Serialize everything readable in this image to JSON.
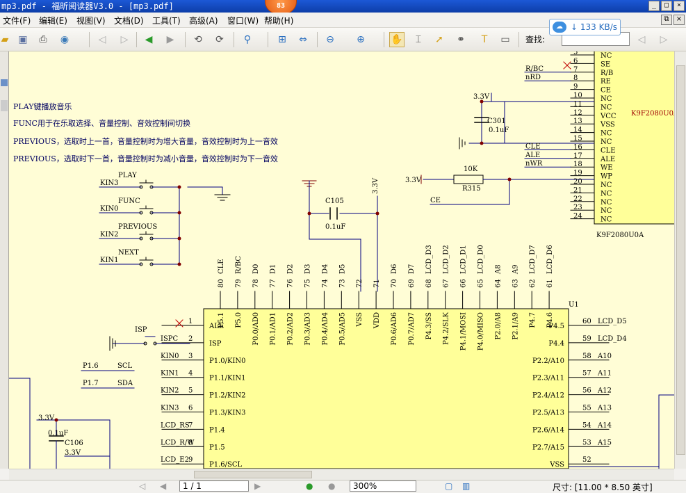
{
  "window": {
    "title": "mp3.pdf - 福昕阅读器V3.0 - [mp3.pdf]",
    "badge": "83",
    "controls": [
      "_",
      "□",
      "×"
    ]
  },
  "menus": [
    "文件(F)",
    "编辑(E)",
    "视图(V)",
    "文档(D)",
    "工具(T)",
    "高级(A)",
    "窗口(W)",
    "帮助(H)"
  ],
  "toolbar": {
    "find_label": "查找:",
    "speed": "133 KB/s"
  },
  "notes": [
    "PLAY键播放音乐",
    "FUNC用于在乐取选择、音量控制、音效控制间切换",
    "PREVIOUS，选取时上一首，音量控制时为增大音量，音效控制时为上一音效",
    "PREVIOUS，选取时下一首，音量控制时为减小音量，音效控制时为下一音效"
  ],
  "buttons": [
    {
      "label": "PLAY",
      "net": "KIN3"
    },
    {
      "label": "FUNC",
      "net": "KIN0"
    },
    {
      "label": "PREVIOUS",
      "net": "KIN2"
    },
    {
      "label": "NEXT",
      "net": "KIN1"
    }
  ],
  "flash": {
    "name": "K9F2080U0A",
    "pins": [
      {
        "n": "5",
        "name": "NC",
        "net": ""
      },
      {
        "n": "6",
        "name": "SE",
        "net": ""
      },
      {
        "n": "7",
        "name": "R/B",
        "net": "R/BC"
      },
      {
        "n": "8",
        "name": "RE",
        "net": "nRD"
      },
      {
        "n": "9",
        "name": "CE",
        "net": ""
      },
      {
        "n": "10",
        "name": "NC",
        "net": ""
      },
      {
        "n": "11",
        "name": "NC",
        "net": ""
      },
      {
        "n": "12",
        "name": "VCC",
        "net": ""
      },
      {
        "n": "13",
        "name": "VSS",
        "net": ""
      },
      {
        "n": "14",
        "name": "NC",
        "net": ""
      },
      {
        "n": "15",
        "name": "NC",
        "net": ""
      },
      {
        "n": "16",
        "name": "CLE",
        "net": "CLE"
      },
      {
        "n": "17",
        "name": "ALE",
        "net": "ALE"
      },
      {
        "n": "18",
        "name": "WE",
        "net": "nWR"
      },
      {
        "n": "19",
        "name": "WP",
        "net": ""
      },
      {
        "n": "20",
        "name": "NC",
        "net": ""
      },
      {
        "n": "21",
        "name": "NC",
        "net": ""
      },
      {
        "n": "22",
        "name": "NC",
        "net": ""
      },
      {
        "n": "23",
        "name": "NC",
        "net": ""
      },
      {
        "n": "24",
        "name": "NC",
        "net": ""
      }
    ]
  },
  "labels": {
    "c301": "C301",
    "c301v": "0.1uF",
    "v33": "3.3V",
    "r315": "R315",
    "r315v": "10K",
    "ce": "CE",
    "c105": "C105",
    "c105v": "0.1uF",
    "isp": "ISP",
    "u1": "U1",
    "c106": "C106",
    "c106v": "0.1uF"
  },
  "u1_top": [
    {
      "n": "80",
      "net": "CLE",
      "pin": "P5.1"
    },
    {
      "n": "79",
      "net": "R/BC",
      "pin": "P5.0"
    },
    {
      "n": "78",
      "net": "D0",
      "pin": "P0.0/AD0"
    },
    {
      "n": "77",
      "net": "D1",
      "pin": "P0.1/AD1"
    },
    {
      "n": "76",
      "net": "D2",
      "pin": "P0.2/AD2"
    },
    {
      "n": "75",
      "net": "D3",
      "pin": "P0.3/AD3"
    },
    {
      "n": "74",
      "net": "D4",
      "pin": "P0.4/AD4"
    },
    {
      "n": "73",
      "net": "D5",
      "pin": "P0.5/AD5"
    },
    {
      "n": "72",
      "net": "",
      "pin": "VSS"
    },
    {
      "n": "71",
      "net": "",
      "pin": "VDD"
    },
    {
      "n": "70",
      "net": "D6",
      "pin": "P0.6/AD6"
    },
    {
      "n": "69",
      "net": "D7",
      "pin": "P0.7/AD7"
    },
    {
      "n": "68",
      "net": "LCD_D3",
      "pin": "P4.3/SS"
    },
    {
      "n": "67",
      "net": "LCD_D2",
      "pin": "P4.2/SLK"
    },
    {
      "n": "66",
      "net": "LCD_D1",
      "pin": "P4.1/MOSI"
    },
    {
      "n": "65",
      "net": "LCD_D0",
      "pin": "P4.0/MISO"
    },
    {
      "n": "64",
      "net": "A8",
      "pin": "P2.0/A8"
    },
    {
      "n": "63",
      "net": "A9",
      "pin": "P2.1/A9"
    },
    {
      "n": "62",
      "net": "LCD_D7",
      "pin": "P4.7"
    },
    {
      "n": "61",
      "net": "LCD_D6",
      "pin": "P4.6"
    }
  ],
  "u1_left": [
    {
      "n": "1",
      "net": "",
      "pin": "ALE"
    },
    {
      "n": "2",
      "net": "ISPC",
      "pin": "ISP"
    },
    {
      "n": "3",
      "net": "KIN0",
      "pin": "P1.0/KIN0"
    },
    {
      "n": "4",
      "net": "KIN1",
      "pin": "P1.1/KIN1"
    },
    {
      "n": "5",
      "net": "KIN2",
      "pin": "P1.2/KIN2"
    },
    {
      "n": "6",
      "net": "KIN3",
      "pin": "P1.3/KIN3"
    },
    {
      "n": "7",
      "net": "LCD_RS",
      "pin": "P1.4"
    },
    {
      "n": "8",
      "net": "LCD_R/W",
      "pin": "P1.5"
    },
    {
      "n": "9",
      "net": "LCD_E2",
      "pin": "P1.6/SCL"
    }
  ],
  "u1_right": [
    {
      "n": "60",
      "net": "LCD_D5",
      "pin": "P4.5"
    },
    {
      "n": "59",
      "net": "LCD_D4",
      "pin": "P4.4"
    },
    {
      "n": "58",
      "net": "A10",
      "pin": "P2.2/A10"
    },
    {
      "n": "57",
      "net": "A11",
      "pin": "P2.3/A11"
    },
    {
      "n": "56",
      "net": "A12",
      "pin": "P2.4/A12"
    },
    {
      "n": "55",
      "net": "A13",
      "pin": "P2.5/A13"
    },
    {
      "n": "54",
      "net": "A14",
      "pin": "P2.6/A14"
    },
    {
      "n": "53",
      "net": "A15",
      "pin": "P2.7/A15"
    },
    {
      "n": "52",
      "net": "",
      "pin": "VSS"
    }
  ],
  "misc_nets": [
    "P1.6",
    "SCL",
    "P1.7",
    "SDA"
  ],
  "status": {
    "page": "1 / 1",
    "zoom": "300%",
    "size": "尺寸: [11.00 * 8.50 英寸]"
  },
  "colors": {
    "page_bg": "#fffdd6",
    "chip_fill": "#ffff99",
    "wire": "#000080",
    "junction": "#800000"
  }
}
